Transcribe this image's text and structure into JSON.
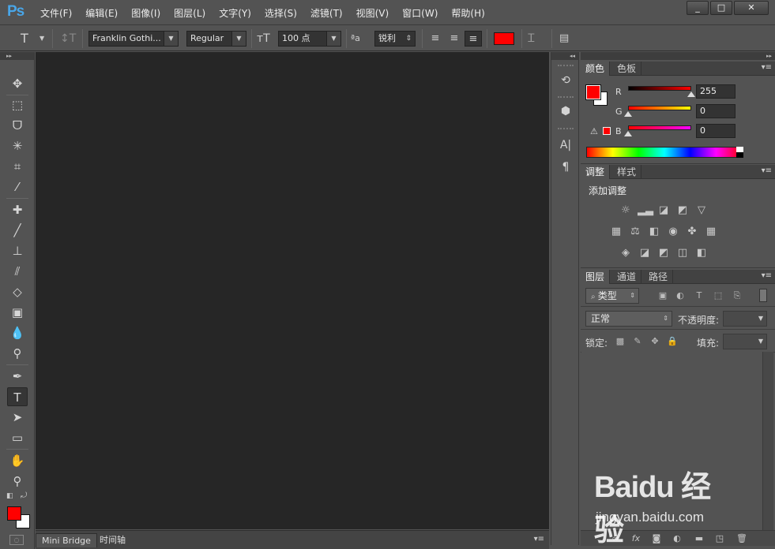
{
  "app": {
    "logo": "Ps"
  },
  "menu": [
    "文件(F)",
    "编辑(E)",
    "图像(I)",
    "图层(L)",
    "文字(Y)",
    "选择(S)",
    "滤镜(T)",
    "视图(V)",
    "窗口(W)",
    "帮助(H)"
  ],
  "window_controls": {
    "minimize": "_",
    "maximize": "□",
    "close": "✕"
  },
  "options_bar": {
    "font_family": "Franklin Gothi...",
    "font_style": "Regular",
    "font_size": "100 点",
    "antialias": "锐利",
    "text_color": "#ff0000"
  },
  "tools": [
    "move",
    "marquee",
    "lasso",
    "magic-wand",
    "crop",
    "eyedropper",
    "healing",
    "brush",
    "stamp",
    "history-brush",
    "eraser",
    "gradient",
    "blur",
    "dodge",
    "pen",
    "type",
    "path-select",
    "rectangle",
    "hand",
    "zoom"
  ],
  "active_tool": "type",
  "colors": {
    "foreground": "#ff0000",
    "background": "#ffffff"
  },
  "bottom_tabs": [
    "Mini Bridge",
    "时间轴"
  ],
  "color_panel": {
    "tabs": [
      "颜色",
      "色板"
    ],
    "channels": [
      {
        "label": "R",
        "value": "255"
      },
      {
        "label": "G",
        "value": "0"
      },
      {
        "label": "B",
        "value": "0"
      }
    ]
  },
  "adjustments_panel": {
    "tabs": [
      "调整",
      "样式"
    ],
    "title": "添加调整"
  },
  "layers_panel": {
    "tabs": [
      "图层",
      "通道",
      "路径"
    ],
    "filter_kind": "类型",
    "blend_mode": "正常",
    "opacity_label": "不透明度:",
    "lock_label": "锁定:",
    "fill_label": "填充:"
  },
  "watermark": {
    "brand": "Baidu 经验",
    "url": "jingyan.baidu.com"
  }
}
